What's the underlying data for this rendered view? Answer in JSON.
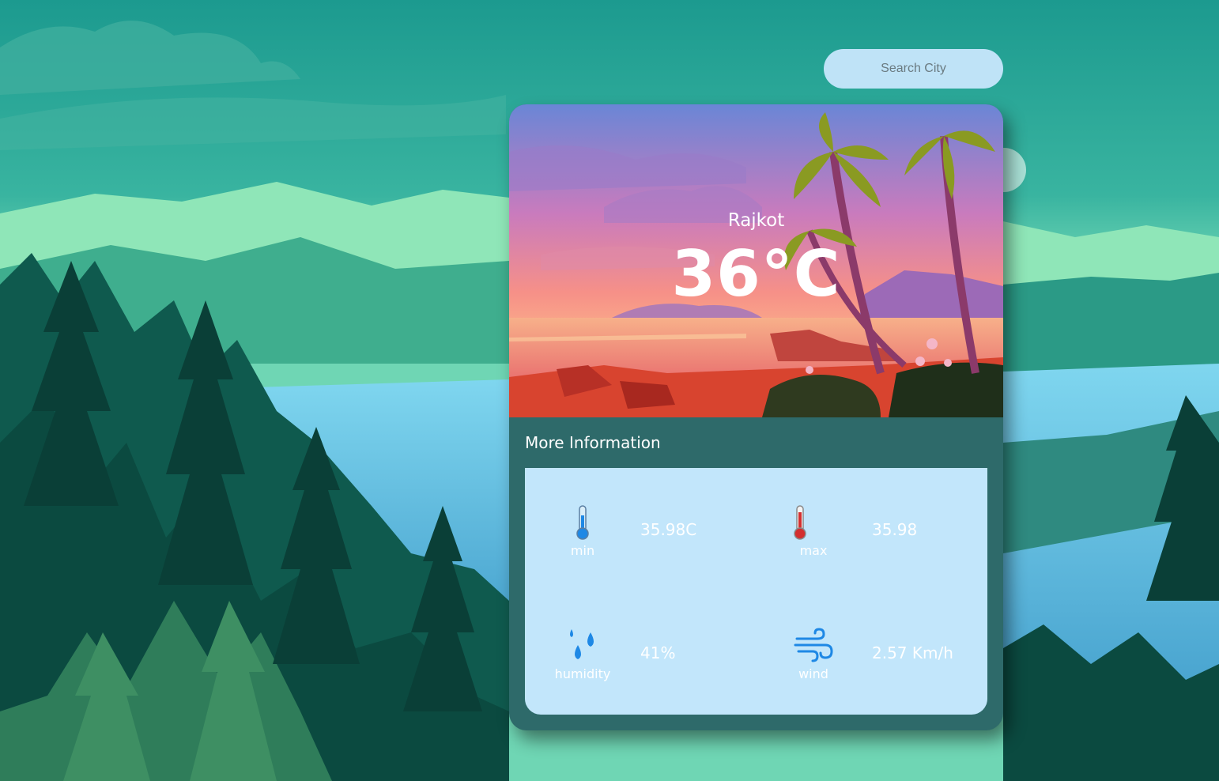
{
  "search": {
    "placeholder": "Search City",
    "value": ""
  },
  "weather": {
    "city": "Rajkot",
    "temperature": "36°C",
    "more_info_title": "More Information",
    "details": {
      "min": {
        "label": "min",
        "value": "35.98C",
        "icon": "thermometer-cold-icon"
      },
      "max": {
        "label": "max",
        "value": "35.98",
        "icon": "thermometer-hot-icon"
      },
      "humidity": {
        "label": "humidity",
        "value": "41%",
        "icon": "water-drops-icon"
      },
      "wind": {
        "label": "wind",
        "value": "2.57 Km/h",
        "icon": "wind-icon"
      }
    }
  },
  "colors": {
    "card_bg": "#2e6a6a",
    "info_panel_bg": "#c2e6fb",
    "search_bg": "#bfe3f7",
    "accent_blue": "#1e88e5",
    "accent_red": "#d32f2f"
  }
}
